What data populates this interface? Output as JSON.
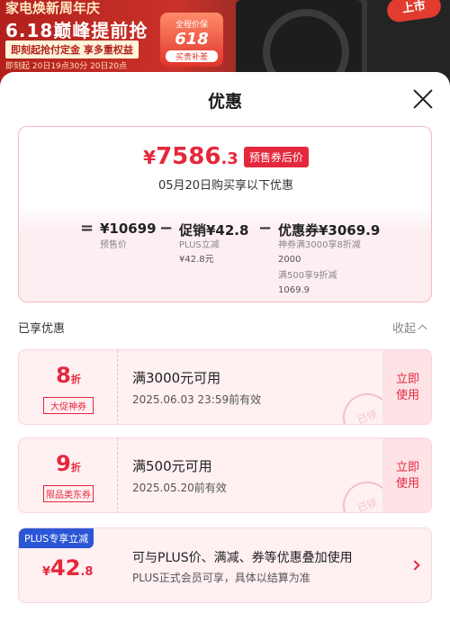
{
  "banner": {
    "line1": "家电焕新周年庆",
    "line2": "6.18巅峰提前抢",
    "line3": "即刻起抢付定金 享多重权益",
    "line4": "即刻起 20日19点30分 20日20点",
    "badge_top": "全程价保",
    "badge_main": "618",
    "badge_bottom": "买贵补差",
    "sticker": "上市"
  },
  "sheet": {
    "title": "优惠"
  },
  "price": {
    "currency": "¥",
    "final_int": "7586",
    "final_dec": ".3",
    "tag": "预售券后价",
    "date_line": "05月20日购买享以下优惠"
  },
  "calc": {
    "eq": "=",
    "minus": "−",
    "presale_amount": "¥10699",
    "presale_label": "预售价",
    "promo_amount": "促销¥42.8",
    "promo_line1": "PLUS立减",
    "promo_line2": "¥42.8元",
    "coupon_amount": "优惠券¥3069.9",
    "coupon_line1": "神券满3000享8折减",
    "coupon_line2": "2000",
    "coupon_line3": "满500享9折减",
    "coupon_line4": "1069.9"
  },
  "section": {
    "title": "已享优惠",
    "collapse": "收起"
  },
  "coupons": [
    {
      "discount": "8",
      "unit": "折",
      "tag": "大促神券",
      "condition": "满3000元可用",
      "valid": "2025.06.03 23:59前有效",
      "button": "立即\n使用",
      "stamp": "已领"
    },
    {
      "discount": "9",
      "unit": "折",
      "tag": "限品类东券",
      "condition": "满500元可用",
      "valid": "2025.05.20前有效",
      "button": "立即\n使用",
      "stamp": "已领"
    }
  ],
  "plus": {
    "tag": "PLUS专享立减",
    "currency": "¥",
    "amount_int": "42",
    "amount_dec": ".8",
    "desc": "可与PLUS价、满减、券等优惠叠加使用",
    "sub": "PLUS正式会员可享，具体以结算为准"
  },
  "colors": {
    "accent": "#e4283c",
    "plus_blue": "#2b57d6",
    "card_bg": "#fff0f2"
  }
}
